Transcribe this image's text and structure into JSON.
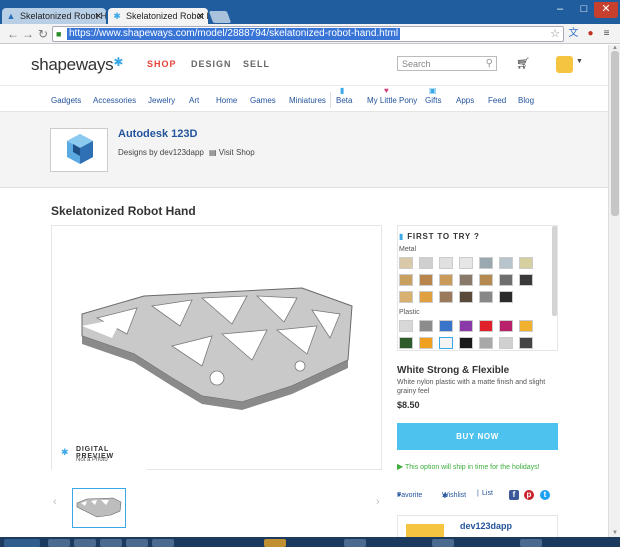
{
  "browser": {
    "tabs": [
      {
        "label": "Skelatonized Robot Hand",
        "icon": "autodesk-icon",
        "active": false
      },
      {
        "label": "Skelatonized Robot Hand",
        "icon": "shapeways-icon",
        "active": true
      }
    ],
    "url": "https://www.shapeways.com/model/2888794/skelatonized-robot-hand.html"
  },
  "header": {
    "logo": "shapeways",
    "nav": {
      "shop": "SHOP",
      "design": "DESIGN",
      "sell": "SELL"
    },
    "search_placeholder": "Search"
  },
  "categories": [
    "Gadgets",
    "Accessories",
    "Jewelry",
    "Art",
    "Home",
    "Games",
    "Miniatures",
    "Beta",
    "My Little Pony",
    "Gifts",
    "Apps",
    "Feed",
    "Blog"
  ],
  "shop": {
    "name": "Autodesk 123D",
    "designer": "Designs by dev123dapp",
    "visit": "Visit Shop"
  },
  "product": {
    "title": "Skelatonized Robot Hand",
    "preview_title": "DIGITAL PREVIEW",
    "preview_sub": "Not a Photo"
  },
  "materials": {
    "heading": "FIRST TO TRY",
    "metal_label": "Metal",
    "plastic_label": "Plastic",
    "metal_swatches": [
      "#d9c9a8",
      "#cfcfcf",
      "#e0e0e0",
      "#e6e6e6",
      "#9aa8b0",
      "#b8c4cc",
      "#d6cfa0",
      "#c8a060",
      "#b8864c",
      "#c99a5a",
      "#8a7a6a",
      "#b48a50",
      "#6e6e6e",
      "#3a3a3a",
      "#d8b070",
      "#e0a040",
      "#9a7a5a",
      "#5a4a3a",
      "#888888",
      "#2a2a2a"
    ],
    "plastic_swatches": [
      "#d8d8d8",
      "#8c8c8c",
      "#3a74c8",
      "#8a3aa8",
      "#e0202a",
      "#b8206a",
      "#f0b030",
      "#2f5a2a",
      "#f0a020",
      "#f4f4f4",
      "#1a1a1a",
      "#a8a8a8",
      "#d0d0d0",
      "#444444"
    ],
    "selected": {
      "name": "White Strong & Flexible",
      "description": "White nylon plastic with a matte finish and slight grainy feel",
      "price": "$8.50"
    }
  },
  "actions": {
    "buy": "BUY NOW",
    "holiday": "This option will ship in time for the holidays!",
    "favorite": "Favorite",
    "wishlist": "Wishlist",
    "list": "List"
  },
  "designer_box": {
    "name": "dev123dapp"
  }
}
